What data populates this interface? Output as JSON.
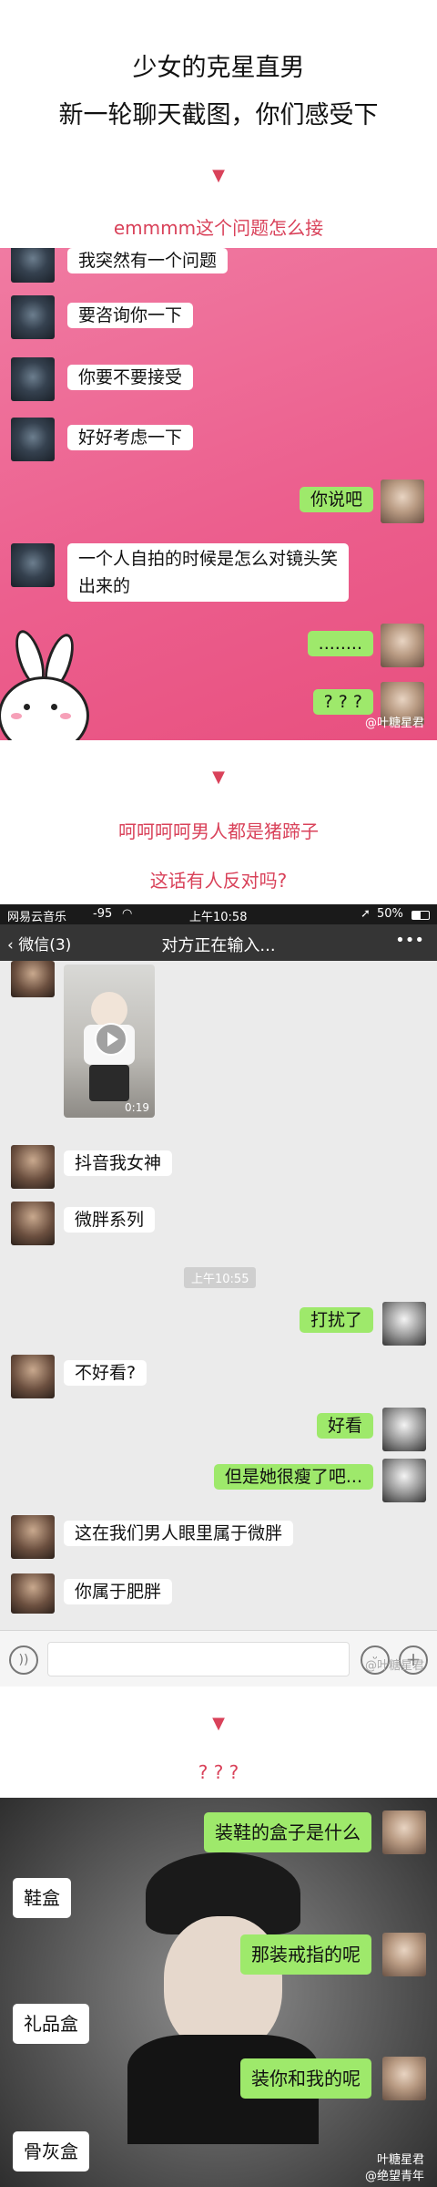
{
  "header": {
    "title_line1": "少女的克星直男",
    "title_line2": "新一轮聊天截图，你们感受下",
    "arrow": "▼",
    "caption1": "emmmm这个问题怎么接",
    "caption2": "呵呵呵呵男人都是猪蹄子",
    "caption3": "这话有人反对吗?",
    "caption4": "? ? ?"
  },
  "chat1": {
    "messages": [
      {
        "side": "in",
        "text": "我突然有一个问题"
      },
      {
        "side": "in",
        "text": "要咨询你一下"
      },
      {
        "side": "in",
        "text": "你要不要接受"
      },
      {
        "side": "in",
        "text": "好好考虑一下"
      },
      {
        "side": "out",
        "text": "你说吧"
      },
      {
        "side": "in",
        "line1": "一个人自拍的时候是怎么对镜头笑",
        "line2": "出来的"
      },
      {
        "side": "out",
        "text": "........"
      },
      {
        "side": "out",
        "text": "? ? ?"
      }
    ],
    "watermark": "@叶糖星君"
  },
  "chat2": {
    "status": {
      "app": "网易云音乐",
      "signal": "-95",
      "time": "上午10:58",
      "battery": "50%"
    },
    "nav": {
      "back_label": "微信(3)",
      "title": "对方正在输入...",
      "more": "•••"
    },
    "video_duration": "0:19",
    "timestamp": "上午10:55",
    "messages": [
      {
        "side": "in",
        "text": "抖音我女神"
      },
      {
        "side": "in",
        "text": "微胖系列"
      },
      {
        "side": "out",
        "text": "打扰了"
      },
      {
        "side": "in",
        "text": "不好看?"
      },
      {
        "side": "out",
        "text": "好看"
      },
      {
        "side": "out",
        "text": "但是她很瘦了吧..."
      },
      {
        "side": "in",
        "text": "这在我们男人眼里属于微胖"
      },
      {
        "side": "in",
        "text": "你属于肥胖"
      }
    ],
    "watermark": "@叶糖星君"
  },
  "chat3": {
    "messages": [
      {
        "side": "out",
        "text": "装鞋的盒子是什么"
      },
      {
        "side": "in",
        "text": "鞋盒"
      },
      {
        "side": "out",
        "text": "那装戒指的呢"
      },
      {
        "side": "in",
        "text": "礼品盒"
      },
      {
        "side": "out",
        "text": "装你和我的呢"
      },
      {
        "side": "in",
        "text": "骨灰盒"
      }
    ],
    "watermark_line1": "叶糖星君",
    "watermark_line2": "@绝望青年"
  },
  "colors": {
    "accent": "#d9425a",
    "wechat_green": "#9ee96b",
    "pink_bg": "#ec5f8e",
    "chat_gray": "#ebebeb",
    "status_bar": "#1a1a1a",
    "nav_bar": "#353535"
  }
}
